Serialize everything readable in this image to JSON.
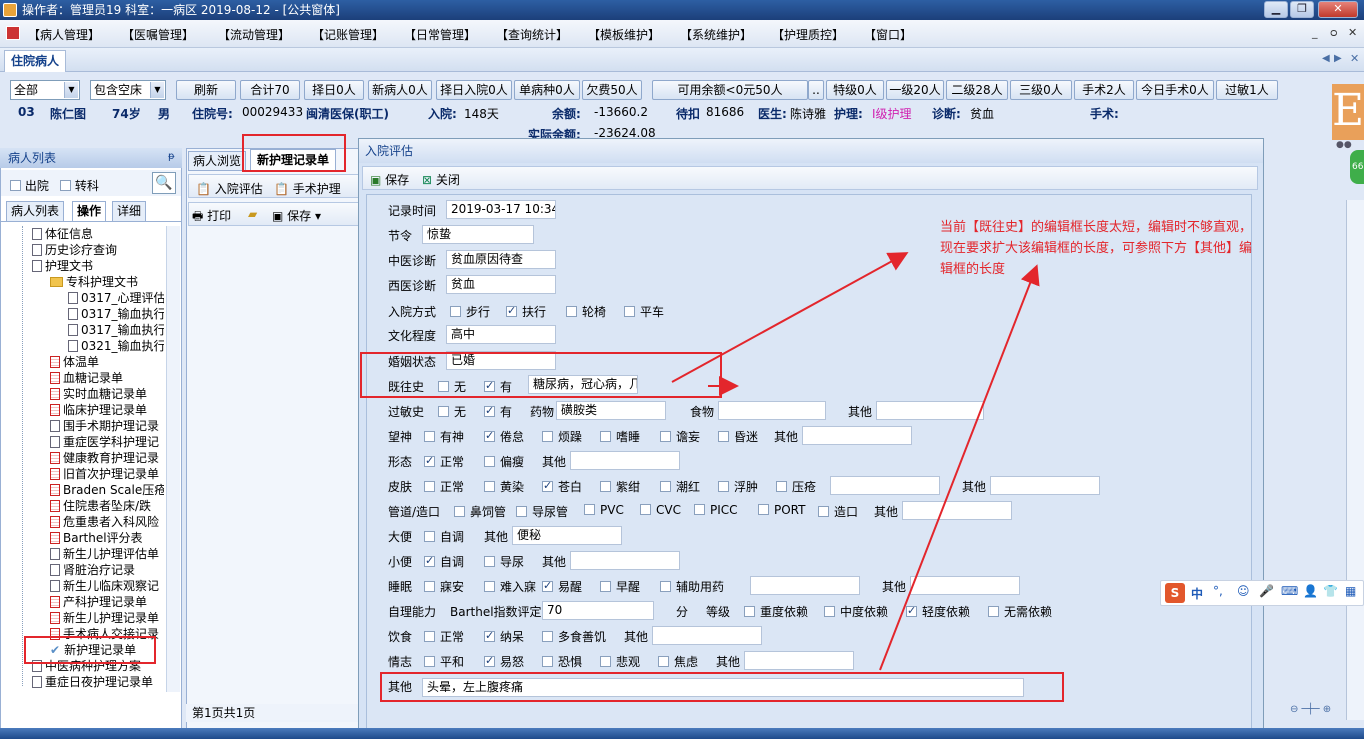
{
  "titlebar": {
    "text": "操作者：管理员19  科室：一病区  2019-08-12 - [公共窗体]"
  },
  "menu": [
    "【病人管理】",
    "【医嘱管理】",
    "【流动管理】",
    "【记账管理】",
    "【日常管理】",
    "【查询统计】",
    "【模板维护】",
    "【系统维护】",
    "【护理质控】",
    "【窗口】"
  ],
  "top_tab": "住院病人",
  "filters": {
    "scope": "全部",
    "bed": "包含空床"
  },
  "toolbar_buttons": [
    "刷新",
    "合计70",
    "择日0人",
    "新病人0人",
    "择日入院0人",
    "单病种0人",
    "欠费50人",
    "可用余额<0元50人",
    "特级0人",
    "一级20人",
    "二级28人",
    "三级0人",
    "手术2人",
    "今日手术0人",
    "过敏1人"
  ],
  "patient": {
    "bed": "03",
    "name": "陈仁图",
    "age": "74岁",
    "sex": "男",
    "admission_no_label": "住院号:",
    "admission_no": "00029433",
    "insurance": "闽清医保(职工)",
    "admit_label": "入院:",
    "admit_days": "148天",
    "balance_label": "余额:",
    "balance": "-13660.2",
    "actual_balance_label": "实际余额:",
    "actual_balance": "-23624.08",
    "pending_label": "待扣",
    "pending": "81686",
    "doctor_label": "医生:",
    "doctor": "陈诗雅",
    "nurse_label": "护理:",
    "nurse_level": "I级护理",
    "diag_label": "诊断:",
    "diagnosis": "贫血",
    "surgery_label": "手术:"
  },
  "left_panel": {
    "header": "病人列表",
    "pin": "ᵽ",
    "out_label": "出院",
    "transfer_label": "转科",
    "tabs": [
      "病人列表",
      "操作",
      "详细"
    ],
    "tree": [
      {
        "label": "体征信息",
        "lvl": 1,
        "ic": "doc"
      },
      {
        "label": "历史诊疗查询",
        "lvl": 1,
        "ic": "doc"
      },
      {
        "label": "护理文书",
        "lvl": 1,
        "ic": "doc"
      },
      {
        "label": "专科护理文书",
        "lvl": 2,
        "ic": "folder"
      },
      {
        "label": "0317_心理评估",
        "lvl": 3,
        "ic": "doc"
      },
      {
        "label": "0317_输血执行",
        "lvl": 3,
        "ic": "doc"
      },
      {
        "label": "0317_输血执行",
        "lvl": 3,
        "ic": "doc"
      },
      {
        "label": "0321_输血执行",
        "lvl": 3,
        "ic": "doc"
      },
      {
        "label": "体温单",
        "lvl": 2,
        "ic": "red"
      },
      {
        "label": "血糖记录单",
        "lvl": 2,
        "ic": "red"
      },
      {
        "label": "实时血糖记录单",
        "lvl": 2,
        "ic": "red"
      },
      {
        "label": "临床护理记录单",
        "lvl": 2,
        "ic": "red"
      },
      {
        "label": "围手术期护理记录",
        "lvl": 2,
        "ic": "doc"
      },
      {
        "label": "重症医学科护理记",
        "lvl": 2,
        "ic": "doc"
      },
      {
        "label": "健康教育护理记录",
        "lvl": 2,
        "ic": "red"
      },
      {
        "label": "旧首次护理记录单",
        "lvl": 2,
        "ic": "red"
      },
      {
        "label": "Braden Scale压疮",
        "lvl": 2,
        "ic": "red"
      },
      {
        "label": "住院患者坠床/跌",
        "lvl": 2,
        "ic": "red"
      },
      {
        "label": "危重患者入科风险",
        "lvl": 2,
        "ic": "red"
      },
      {
        "label": "Barthel评分表",
        "lvl": 2,
        "ic": "red"
      },
      {
        "label": "新生儿护理评估单",
        "lvl": 2,
        "ic": "doc"
      },
      {
        "label": "肾脏治疗记录",
        "lvl": 2,
        "ic": "doc"
      },
      {
        "label": "新生儿临床观察记",
        "lvl": 2,
        "ic": "doc"
      },
      {
        "label": "产科护理记录单",
        "lvl": 2,
        "ic": "red"
      },
      {
        "label": "新生儿护理记录单",
        "lvl": 2,
        "ic": "red"
      },
      {
        "label": "手术病人交接记录",
        "lvl": 2,
        "ic": "red"
      },
      {
        "label": "新护理记录单",
        "lvl": 2,
        "ic": "check"
      },
      {
        "label": "中医病种护理方案",
        "lvl": 1,
        "ic": "doc"
      },
      {
        "label": "重症日夜护理记录单",
        "lvl": 1,
        "ic": "doc"
      }
    ]
  },
  "mid": {
    "tab1": "病人浏览",
    "tab2": "新护理记录单",
    "sub1": "入院评估",
    "sub2": "手术护理",
    "print": "打印",
    "save": "保存",
    "page_status": "第1页共1页"
  },
  "dialog": {
    "title": "入院评估",
    "save": "保存",
    "close": "关闭",
    "fields": {
      "record_time": {
        "label": "记录时间",
        "value": "2019-03-17 10:34"
      },
      "solar_term": {
        "label": "节令",
        "value": "惊蛰"
      },
      "tcm_diag": {
        "label": "中医诊断",
        "value": "贫血原因待查"
      },
      "wm_diag": {
        "label": "西医诊断",
        "value": "贫血"
      },
      "admit_way": {
        "label": "入院方式",
        "options": [
          {
            "t": "步行",
            "c": false
          },
          {
            "t": "扶行",
            "c": true
          },
          {
            "t": "轮椅",
            "c": false
          },
          {
            "t": "平车",
            "c": false
          }
        ]
      },
      "education": {
        "label": "文化程度",
        "value": "高中"
      },
      "marital": {
        "label": "婚姻状态",
        "value": "已婚"
      },
      "history": {
        "label": "既往史",
        "no": "无",
        "yes": "有",
        "value": "糖尿病，冠心病，几"
      },
      "allergy": {
        "label": "过敏史",
        "no": "无",
        "yes": "有",
        "drug_label": "药物",
        "drug": "磺胺类",
        "food_label": "食物",
        "food": "",
        "other_label": "其他",
        "other": ""
      },
      "spirit": {
        "label": "望神",
        "options": [
          {
            "t": "有神",
            "c": false
          },
          {
            "t": "倦怠",
            "c": true
          },
          {
            "t": "烦躁",
            "c": false
          },
          {
            "t": "嗜睡",
            "c": false
          },
          {
            "t": "谵妄",
            "c": false
          },
          {
            "t": "昏迷",
            "c": false
          }
        ],
        "other_label": "其他"
      },
      "form": {
        "label": "形态",
        "options": [
          {
            "t": "正常",
            "c": true
          },
          {
            "t": "偏瘦",
            "c": false
          }
        ],
        "other_label": "其他"
      },
      "skin": {
        "label": "皮肤",
        "options": [
          {
            "t": "正常",
            "c": false
          },
          {
            "t": "黄染",
            "c": false
          },
          {
            "t": "苍白",
            "c": true
          },
          {
            "t": "紫绀",
            "c": false
          },
          {
            "t": "潮红",
            "c": false
          },
          {
            "t": "浮肿",
            "c": false
          },
          {
            "t": "压疮",
            "c": false
          }
        ],
        "other_label": "其他"
      },
      "tube": {
        "label": "管道/造口",
        "options": [
          {
            "t": "鼻饲管",
            "c": false
          },
          {
            "t": "导尿管",
            "c": false
          },
          {
            "t": "PVC",
            "c": false
          },
          {
            "t": "CVC",
            "c": false
          },
          {
            "t": "PICC",
            "c": false
          },
          {
            "t": "PORT",
            "c": false
          },
          {
            "t": "造口",
            "c": false
          }
        ],
        "other_label": "其他"
      },
      "stool": {
        "label": "大便",
        "options": [
          {
            "t": "自调",
            "c": false
          }
        ],
        "other_label": "其他",
        "other": "便秘"
      },
      "urine": {
        "label": "小便",
        "options": [
          {
            "t": "自调",
            "c": true
          },
          {
            "t": "导尿",
            "c": false
          }
        ],
        "other_label": "其他"
      },
      "sleep": {
        "label": "睡眠",
        "options": [
          {
            "t": "寐安",
            "c": false
          },
          {
            "t": "难入寐",
            "c": false
          },
          {
            "t": "易醒",
            "c": true
          },
          {
            "t": "早醒",
            "c": false
          },
          {
            "t": "辅助用药",
            "c": false
          }
        ],
        "other_label": "其他"
      },
      "selfcare": {
        "label": "自理能力",
        "barthel_label": "Barthel指数评定",
        "barthel": "70",
        "unit": "分",
        "level_label": "等级",
        "options": [
          {
            "t": "重度依赖",
            "c": false
          },
          {
            "t": "中度依赖",
            "c": false
          },
          {
            "t": "轻度依赖",
            "c": true
          },
          {
            "t": "无需依赖",
            "c": false
          }
        ]
      },
      "diet": {
        "label": "饮食",
        "options": [
          {
            "t": "正常",
            "c": false
          },
          {
            "t": "纳呆",
            "c": true
          },
          {
            "t": "多食善饥",
            "c": false
          }
        ],
        "other_label": "其他"
      },
      "mood": {
        "label": "情志",
        "options": [
          {
            "t": "平和",
            "c": false
          },
          {
            "t": "易怒",
            "c": true
          },
          {
            "t": "恐惧",
            "c": false
          },
          {
            "t": "悲观",
            "c": false
          },
          {
            "t": "焦虑",
            "c": false
          }
        ],
        "other_label": "其他"
      },
      "other": {
        "label": "其他",
        "value": "头晕，左上腹疼痛"
      }
    }
  },
  "annotation": "当前【既往史】的编辑框长度太短，编辑时不够直观，现在要求扩大该编辑框的长度，可参照下方【其他】编辑框的长度",
  "ime": {
    "text": "中"
  },
  "colors": {
    "annotation": "#e3262c",
    "header": "#15428b"
  }
}
